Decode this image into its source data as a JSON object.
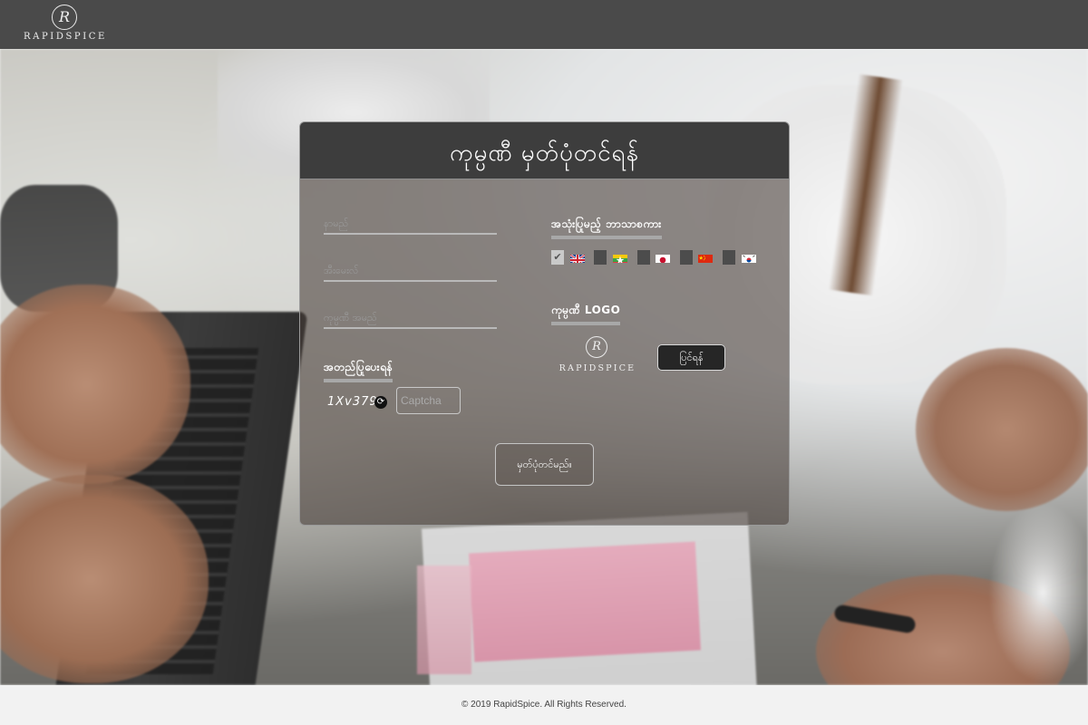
{
  "header": {
    "brand_mark": "R",
    "brand_name": "RAPIDSPICE"
  },
  "card": {
    "title": "ကုမ္ပဏီ မှတ်ပုံတင်ရန်",
    "fields": {
      "name_placeholder": "နာမည်",
      "email_placeholder": "အီးမေးလ်",
      "company_placeholder": "ကုမ္ပဏီ အမည်"
    },
    "verify": {
      "title": "အတည်ပြုပေးရန်",
      "captcha_code": "1Xv379",
      "captcha_placeholder": "Captcha"
    },
    "language": {
      "title": "အသုံးပြုမည့် ဘာသာစကား",
      "options": [
        {
          "flag": "uk-flag",
          "checked": true
        },
        {
          "flag": "myanmar-flag",
          "checked": false
        },
        {
          "flag": "japan-flag",
          "checked": false
        },
        {
          "flag": "china-flag",
          "checked": false
        },
        {
          "flag": "korea-flag",
          "checked": false
        }
      ]
    },
    "logo": {
      "title": "ကုမ္ပဏီ LOGO",
      "preview_mark": "R",
      "preview_name": "RAPIDSPICE",
      "change_label": "ပြင်ရန်"
    },
    "register_label": "မှတ်ပုံတင်မည်။"
  },
  "footer": {
    "copyright": "© 2019 RapidSpice. All Rights Reserved."
  },
  "colors": {
    "header_bg": "#4a4a4a",
    "card_header_bg": "#3d3d3d",
    "footer_bg": "#f2f2f2"
  }
}
